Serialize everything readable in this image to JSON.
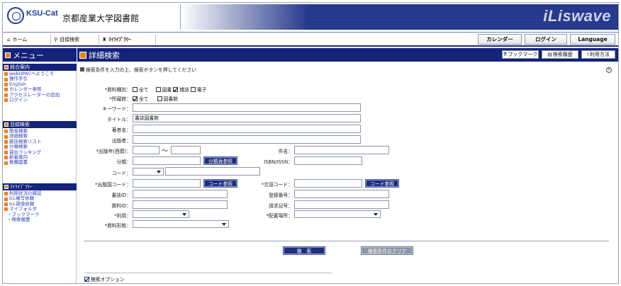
{
  "header": {
    "logo_text": "KSU-Cat",
    "library_name": "京都産業大学図書館",
    "brand": "iLiswave"
  },
  "nav": {
    "home": "ホーム",
    "catalog_search": "目録検索",
    "my_library": "ﾏｲﾗｲﾌﾞﾗﾘｰ",
    "calendar": "カレンダー",
    "login": "ログイン",
    "language": "Language"
  },
  "sidebar": {
    "menu_title": "メニュー",
    "sections": [
      {
        "title": "総合案内",
        "links": [
          "webOPACへようこそ",
          "操作手引",
          "English",
          "カレンダー参照",
          "アクセスレーターの追加",
          "ログイン"
        ]
      },
      {
        "title": "目録検索",
        "links": [
          "簡易検索",
          "詳細検索",
          "雑誌検索リスト",
          "分類検索",
          "貸出ランキング",
          "新着案内",
          "推薦図書"
        ]
      },
      {
        "title": "ﾏｲﾗｲﾌﾞﾗﾘｰ",
        "links": [
          "利用状況の確認",
          "ILL複写依頼",
          "ILL貸借依頼",
          "マイフォルダ"
        ],
        "sublinks": [
          "・ブックマーク",
          "・検索履歴"
        ]
      }
    ]
  },
  "main": {
    "title": "詳細検索",
    "buttons": {
      "bookmark": "ブックマーク",
      "history": "検索履歴",
      "howto": "利用方法"
    },
    "instruction": "検索条件を入力の上、検索ボタンを押してください",
    "form": {
      "material_type_label": "*資料種別：",
      "material_types": [
        {
          "label": "全て",
          "checked": false
        },
        {
          "label": "図書",
          "checked": false
        },
        {
          "label": "雑誌",
          "checked": true
        },
        {
          "label": "電子",
          "checked": false
        }
      ],
      "location_label": "*所蔵館：",
      "locations": [
        {
          "label": "全て",
          "checked": true
        },
        {
          "label": "図書館",
          "checked": false
        }
      ],
      "keyword_label": "キーワード：",
      "title_label": "タイトル：",
      "title_value": "書誌図書館",
      "author_label": "著者名：",
      "publisher_label": "出版者：",
      "pubyear_label": "*出版年(西暦)：",
      "tilde": "〜",
      "subject_label": "件名：",
      "class_label": "分類：",
      "class_button": "分類表参照",
      "isbn_label": "ISBN/ISSN：",
      "code_label": "コード：",
      "country_label": "*出版国コード：",
      "code_ref_button": "コード参照",
      "language_label": "*言語コード：",
      "bibid_label": "書誌ID：",
      "regno_label": "登録番号：",
      "materialid_label": "資料ID：",
      "callno_label": "請求記号：",
      "use_label": "*利用：",
      "place_label": "*配置場所：",
      "form_label": "*資料形態："
    },
    "search_button": "検　索",
    "clear_button": "検索条件のクリア",
    "search_options": "検索オプション"
  },
  "colors": {
    "navy": "#14227a",
    "accent_orange": "#f07f1a",
    "link_blue": "#2b3fb8"
  }
}
